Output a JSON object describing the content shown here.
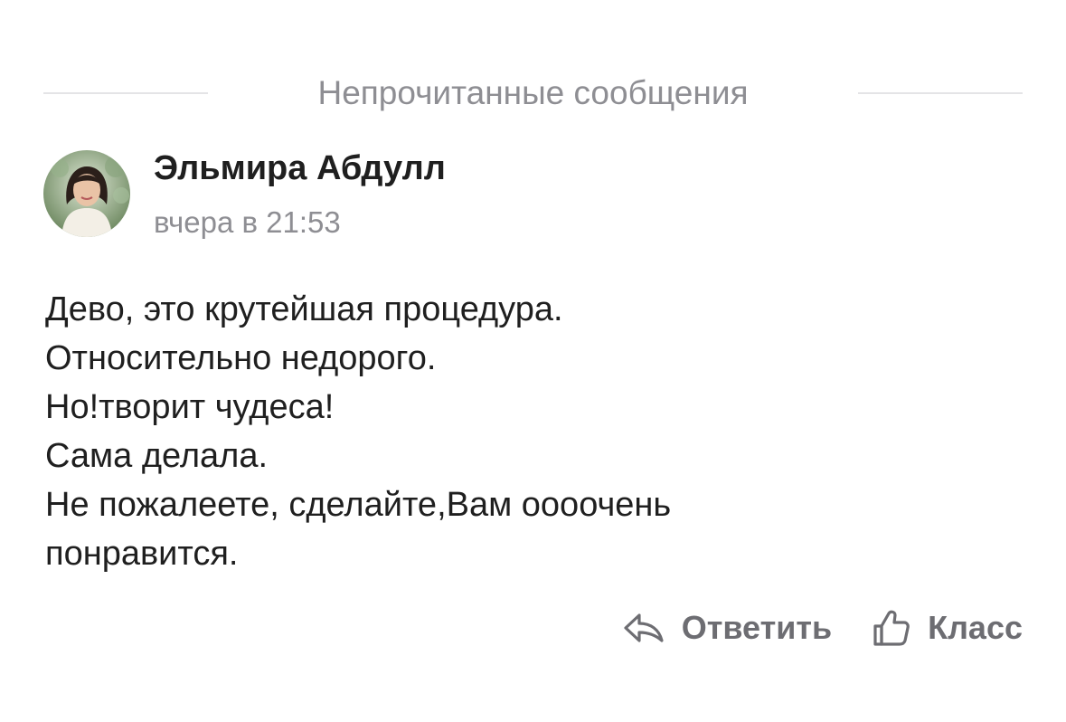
{
  "divider": {
    "label": "Непрочитанные сообщения"
  },
  "comment": {
    "author": "Эльмира Абдулл",
    "timestamp": "вчера в 21:53",
    "lines": [
      "Дево, это крутейшая процедура.",
      "Относительно недорого.",
      "Но!творит чудеса!",
      "Сама делала.",
      "Не пожалеете, сделайте,Вам оооочень",
      "понравится."
    ]
  },
  "actions": {
    "reply_label": "Ответить",
    "reply_icon": "reply-arrow-icon",
    "like_label": "Класс",
    "like_icon": "thumbs-up-icon"
  },
  "colors": {
    "muted_text": "#8e8e93",
    "action_text": "#6d6d72",
    "body_text": "#1f1f1f",
    "divider_line": "#e4e4e6"
  }
}
